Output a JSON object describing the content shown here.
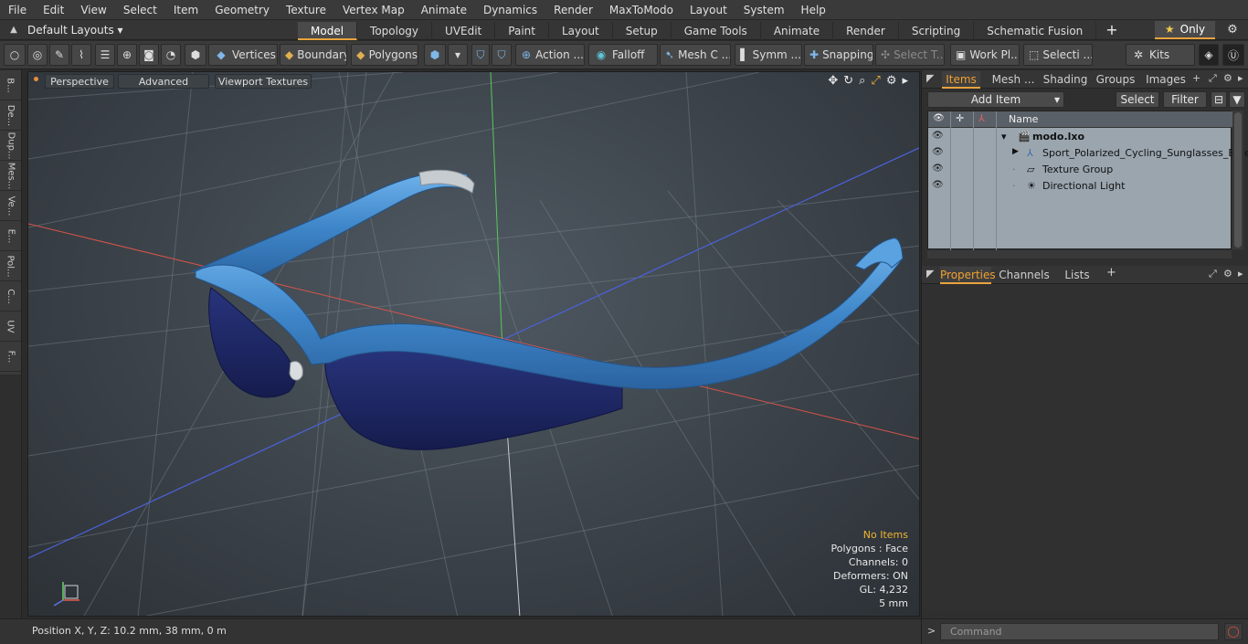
{
  "menu": [
    "File",
    "Edit",
    "View",
    "Select",
    "Item",
    "Geometry",
    "Texture",
    "Vertex Map",
    "Animate",
    "Dynamics",
    "Render",
    "MaxToModo",
    "Layout",
    "System",
    "Help"
  ],
  "layoutbar": {
    "default_layouts": "Default Layouts ▾",
    "tabs": [
      "Model",
      "Topology",
      "UVEdit",
      "Paint",
      "Layout",
      "Setup",
      "Game Tools",
      "Animate",
      "Render",
      "Scripting",
      "Schematic Fusion"
    ],
    "active_tab": "Model",
    "add_tab": "+",
    "only": "Only"
  },
  "toolbar": {
    "vertices": "Vertices",
    "boundary": "Boundary",
    "polygons": "Polygons",
    "action": "Action ...",
    "falloff": "Falloff",
    "mesh_c": "Mesh C ...",
    "symm": "Symm ...",
    "snapping": "Snapping",
    "select_t": "Select T...",
    "work_pl": "Work Pl...",
    "selecti": "Selecti ...",
    "kits": "Kits"
  },
  "left_tabs": [
    "B...",
    "De...",
    "Dup...",
    "Mes...",
    "Ve...",
    "E...",
    "Pol...",
    "C...",
    "UV",
    "F..."
  ],
  "viewport": {
    "perspective": "Perspective",
    "advanced": "Advanced",
    "viewport_textures": "Viewport Textures",
    "info": {
      "no_items": "No Items",
      "polygons": "Polygons : Face",
      "channels": "Channels: 0",
      "deformers": "Deformers: ON",
      "gl": "GL: 4,232",
      "scale": "5 mm"
    }
  },
  "status": {
    "position": "Position X, Y, Z:   10.2 mm, 38 mm, 0 m"
  },
  "items_panel": {
    "tabs": [
      "Items",
      "Mesh ...",
      "Shading",
      "Groups",
      "Images"
    ],
    "active_tab": "Items",
    "add_item": "Add Item",
    "select": "Select",
    "filter": "Filter",
    "col_name": "Name",
    "rows": [
      {
        "label": "modo.lxo",
        "bold": true
      },
      {
        "label": "Sport_Polarized_Cycling_Sunglasses_Blue"
      },
      {
        "label": "Texture Group"
      },
      {
        "label": "Directional Light"
      }
    ]
  },
  "properties_panel": {
    "tabs": [
      "Properties",
      "Channels",
      "Lists"
    ],
    "active_tab": "Properties",
    "add": "+"
  },
  "command": {
    "prompt": ">",
    "placeholder": "Command"
  },
  "colors": {
    "accent": "#e8a33d",
    "frame_blue": "#3e86c9",
    "lens": "#1f2a6e",
    "no_items": "#f0b531"
  }
}
